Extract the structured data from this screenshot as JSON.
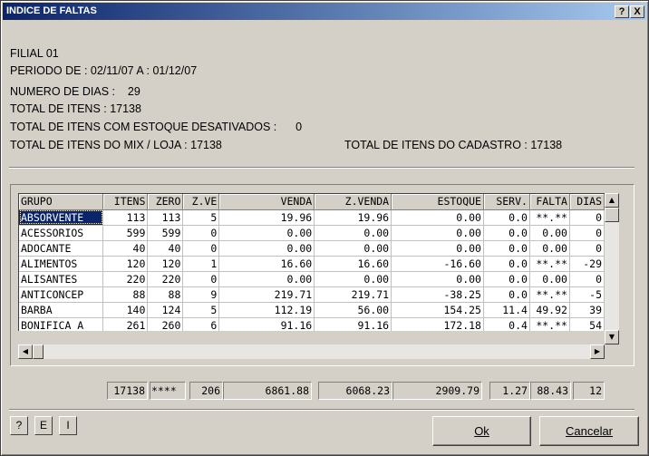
{
  "window": {
    "title": "INDICE DE FALTAS",
    "help_label": "?",
    "close_label": "X"
  },
  "info": {
    "filial": "FILIAL 01",
    "periodo": "PERIODO DE : 02/11/07 A : 01/12/07",
    "numero_dias": "NUMERO DE DIAS :    29",
    "total_itens": "TOTAL DE ITENS : 17138",
    "total_desativados": "TOTAL DE ITENS COM ESTOQUE DESATIVADOS :      0",
    "total_mix": "TOTAL DE ITENS DO MIX / LOJA : 17138",
    "total_cadastro": "TOTAL DE ITENS DO CADASTRO : 17138"
  },
  "grid": {
    "columns": [
      "GRUPO",
      "ITENS",
      "ZERO",
      "Z.VE",
      "VENDA",
      "Z.VENDA",
      "ESTOQUE",
      "SERV.",
      "FALTA",
      "DIAS"
    ],
    "rows": [
      [
        "ABSORVENTE",
        "113",
        "113",
        "5",
        "19.96",
        "19.96",
        "0.00",
        "0.0",
        "**.**",
        "0"
      ],
      [
        "ACESSORIOS",
        "599",
        "599",
        "0",
        "0.00",
        "0.00",
        "0.00",
        "0.0",
        "0.00",
        "0"
      ],
      [
        "ADOCANTE",
        "40",
        "40",
        "0",
        "0.00",
        "0.00",
        "0.00",
        "0.0",
        "0.00",
        "0"
      ],
      [
        "ALIMENTOS",
        "120",
        "120",
        "1",
        "16.60",
        "16.60",
        "-16.60",
        "0.0",
        "**.**",
        "-29"
      ],
      [
        "ALISANTES",
        "220",
        "220",
        "0",
        "0.00",
        "0.00",
        "0.00",
        "0.0",
        "0.00",
        "0"
      ],
      [
        "ANTICONCEP",
        "88",
        "88",
        "9",
        "219.71",
        "219.71",
        "-38.25",
        "0.0",
        "**.**",
        "-5"
      ],
      [
        "BARBA",
        "140",
        "124",
        "5",
        "112.19",
        "56.00",
        "154.25",
        "11.4",
        "49.92",
        "39"
      ],
      [
        "BONIFICA A",
        "261",
        "260",
        "6",
        "91.16",
        "91.16",
        "172.18",
        "0.4",
        "**.**",
        "54"
      ]
    ]
  },
  "totals": [
    "17138",
    "****",
    "206",
    "6861.88",
    "6068.23",
    "2909.79",
    "1.27",
    "88.43",
    "12"
  ],
  "buttons": {
    "help": "?",
    "e": "E",
    "i": "I",
    "ok": "Ok",
    "cancel": "Cancelar"
  }
}
